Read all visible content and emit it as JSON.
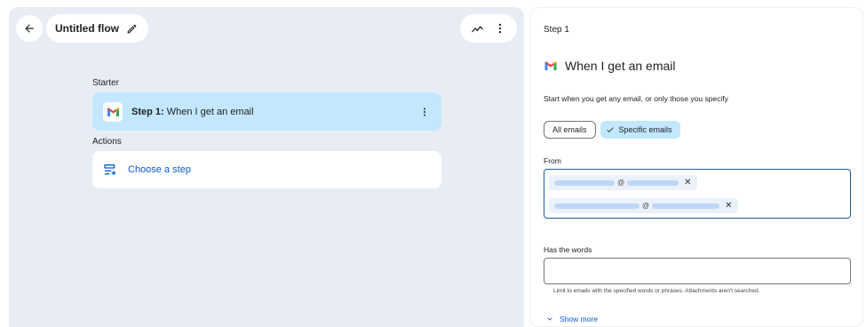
{
  "flow": {
    "title": "Untitled flow",
    "back_icon": "arrow-back-icon",
    "edit_icon": "pencil-icon"
  },
  "canvas": {
    "starter_label": "Starter",
    "step1_prefix": "Step 1:",
    "step1_text": " When I get an email",
    "actions_label": "Actions",
    "choose_step": "Choose a step"
  },
  "panel": {
    "step_label": "Step 1",
    "title": "When I get an email",
    "description": "Start when you get any email, or only those you specify",
    "chip_all": "All emails",
    "chip_specific": "Specific emails",
    "from_label": "From",
    "from_emails": [
      {
        "at": "@"
      },
      {
        "at": "@"
      }
    ],
    "has_words_label": "Has the words",
    "has_words_value": "",
    "hint": "Limit to emails with the specified words or phrases. Attachments aren't searched.",
    "show_more": "Show more"
  },
  "colors": {
    "canvas_bg": "#e8edf5",
    "selected": "#c2e7ff",
    "link": "#0b57d0",
    "focus_border": "#1a5f9e"
  }
}
